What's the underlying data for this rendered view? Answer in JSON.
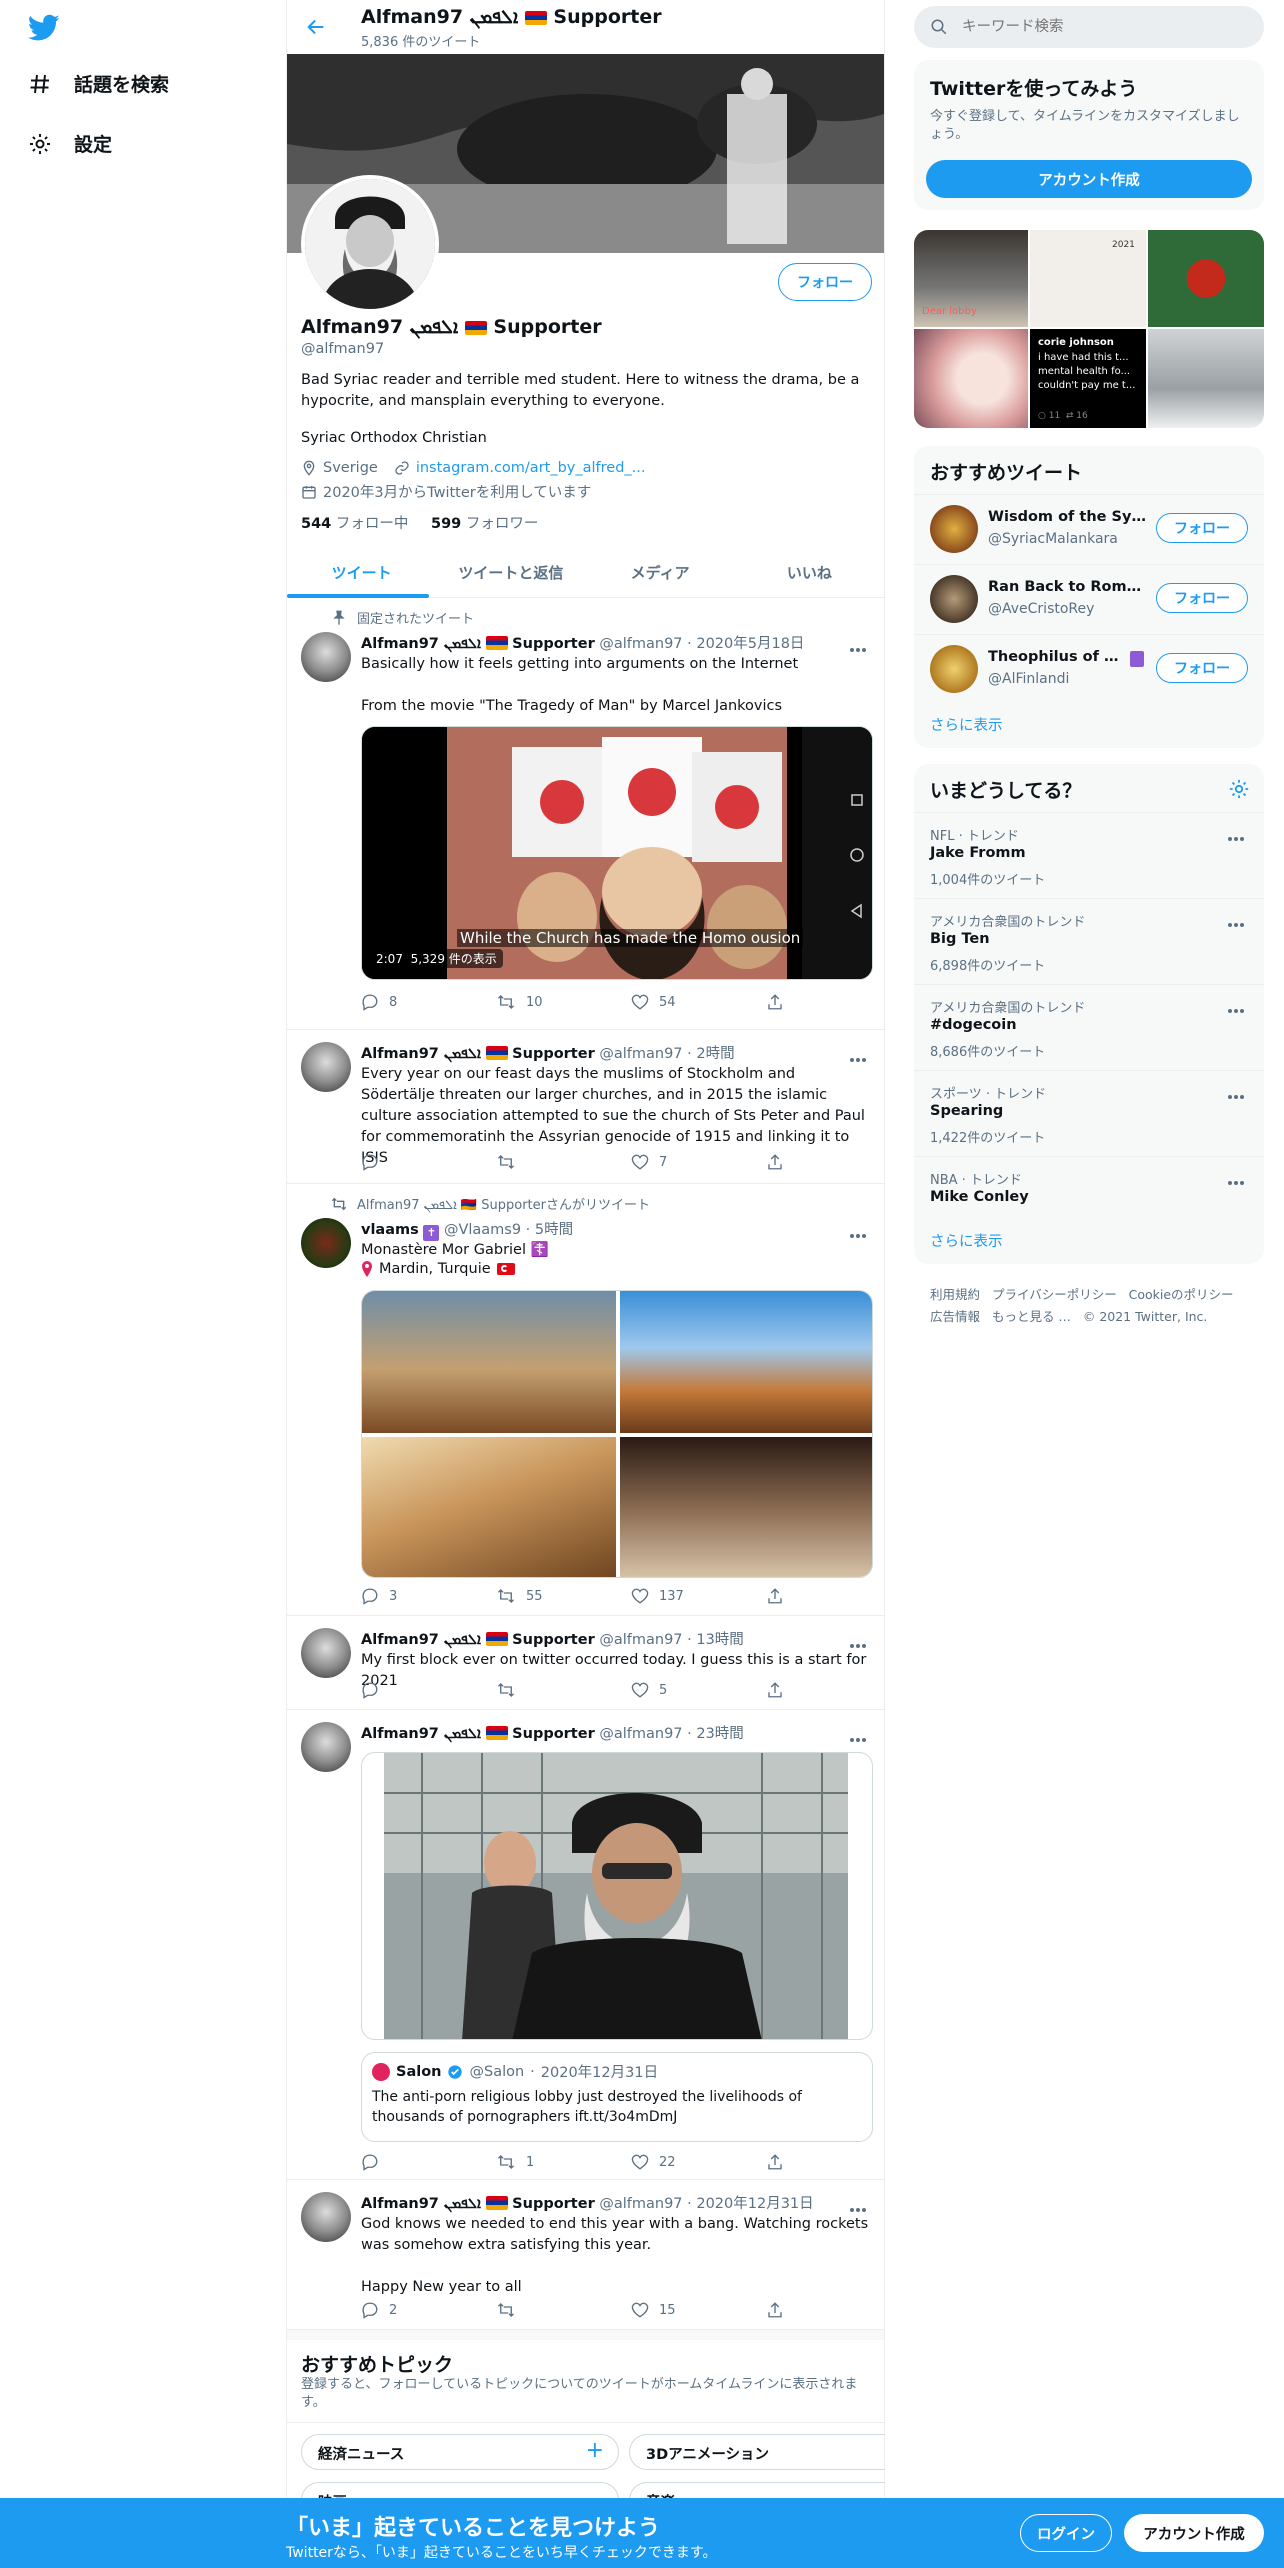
{
  "nav": {
    "explore_label": "話題を検索",
    "settings_label": "設定"
  },
  "header": {
    "name": "Alfman97 ܐܠܦܡܢ",
    "supporter": "Supporter",
    "tweet_count": "5,836 件のツイート"
  },
  "profile": {
    "name": "Alfman97 ܐܠܦܡܢ",
    "supporter": "Supporter",
    "handle": "@alfman97",
    "follow_label": "フォロー",
    "bio": "Bad Syriac reader and terrible med student. Here to witness the drama, be a hypocrite, and mansplain everything to everyone.",
    "bio2": "Syriac Orthodox Christian",
    "location": "Sverige",
    "link": "instagram.com/art_by_alfred_...",
    "joined": "2020年3月からTwitterを利用しています",
    "following_count": "544",
    "following_label": "フォロー中",
    "followers_count": "599",
    "followers_label": "フォロワー"
  },
  "tabs": [
    "ツイート",
    "ツイートと返信",
    "メディア",
    "いいね"
  ],
  "tweets": [
    {
      "pinned_label": "固定されたツイート",
      "name": "Alfman97 ܐܠܦܡܢ",
      "supporter": "Supporter",
      "handle": "@alfman97",
      "time": "2020年5月18日",
      "text": "Basically how it feels getting into arguments on the Internet\n\nFrom the movie \"The Tragedy of Man\" by Marcel Jankovics",
      "video_caption": "While the Church has made the Homo ousion",
      "video_duration": "2:07",
      "video_views": "5,329 件の表示",
      "replies": "8",
      "retweets": "10",
      "likes": "54"
    },
    {
      "name": "Alfman97 ܐܠܦܡܢ",
      "supporter": "Supporter",
      "handle": "@alfman97",
      "time": "2時間",
      "text": "Every year on our feast days the muslims of Stockholm and Södertälje threaten our larger churches, and in 2015 the islamic culture association attempted to sue the church of Sts Peter and Paul for commemoratinh the Assyrian genocide of 1915 and linking it to ISIS",
      "replies": "",
      "retweets": "",
      "likes": "7"
    },
    {
      "retweet_label": "Alfman97 ܐܠܦܡܢ 🇦🇲 Supporterさんがリツイート",
      "name": "vlaams",
      "handle": "@Vlaams9",
      "time": "5時間",
      "text_line1": "Monastère Mor Gabriel ☦️",
      "text_line2": "Mardin, Turquie",
      "replies": "3",
      "retweets": "55",
      "likes": "137"
    },
    {
      "name": "Alfman97 ܐܠܦܡܢ",
      "supporter": "Supporter",
      "handle": "@alfman97",
      "time": "13時間",
      "text": "My first block ever on twitter occurred today. I guess this is a start for 2021",
      "replies": "",
      "retweets": "",
      "likes": "5"
    },
    {
      "name": "Alfman97 ܐܠܦܡܢ",
      "supporter": "Supporter",
      "handle": "@alfman97",
      "time": "23時間",
      "quote_name": "Salon",
      "quote_handle": "@Salon",
      "quote_time": "2020年12月31日",
      "quote_text": "The anti-porn religious lobby just destroyed the livelihoods of thousands of pornographers ift.tt/3o4mDmJ",
      "replies": "",
      "retweets": "1",
      "likes": "22"
    },
    {
      "name": "Alfman97 ܐܠܦܡܢ",
      "supporter": "Supporter",
      "handle": "@alfman97",
      "time": "2020年12月31日",
      "text": "God knows we needed to end this year with a bang. Watching rockets was somehow extra satisfying this year.\n\nHappy New year to all",
      "replies": "2",
      "retweets": "",
      "likes": "15"
    }
  ],
  "topics": {
    "title": "おすすめトピック",
    "subtitle": "登録すると、フォローしているトピックについてのツイートがホームタイムラインに表示されます。",
    "items": [
      "経済ニュース",
      "3Dアニメーション",
      "映画",
      "音楽"
    ]
  },
  "search": {
    "placeholder": "キーワード検索"
  },
  "signup": {
    "title": "Twitterを使ってみよう",
    "desc": "今すぐ登録して、タイムラインをカスタマイズしましょう。",
    "button": "アカウント作成"
  },
  "media_grid": {
    "cell1_caption": "Dear lobby",
    "cell2_caption": "2021",
    "cell5_name": "corie johnson",
    "cell5_text": "i have had this t... mental health fo... couldn't pay me t...",
    "cell5_replies": "11",
    "cell5_retweets": "16"
  },
  "recommended": {
    "title": "おすすめツイート",
    "users": [
      {
        "name": "Wisdom of the Syriac...",
        "handle": "@SyriacMalankara",
        "button": "フォロー",
        "color": "#8a4b1e"
      },
      {
        "name": "Ran Back to Rome M...",
        "handle": "@AveCristoRey",
        "button": "フォロー",
        "color": "#6b5a44"
      },
      {
        "name": "Theophilus of Finland",
        "handle": "@AlFinlandi",
        "button": "フォロー",
        "color": "#c89a2a"
      }
    ],
    "more": "さらに表示"
  },
  "trends": {
    "title": "いまどうしてる？",
    "items": [
      {
        "category": "NFL · トレンド",
        "name": "Jake Fromm",
        "count": "1,004件のツイート"
      },
      {
        "category": "アメリカ合衆国のトレンド",
        "name": "Big Ten",
        "count": "6,898件のツイート"
      },
      {
        "category": "アメリカ合衆国のトレンド",
        "name": "#dogecoin",
        "count": "8,686件のツイート"
      },
      {
        "category": "スポーツ · トレンド",
        "name": "Spearing",
        "count": "1,422件のツイート"
      },
      {
        "category": "NBA · トレンド",
        "name": "Mike Conley",
        "count": ""
      }
    ],
    "more": "さらに表示"
  },
  "footer": {
    "links": [
      "利用規約",
      "プライバシーポリシー",
      "Cookieのポリシー",
      "広告情報",
      "もっと見る …"
    ],
    "copyright": "© 2021 Twitter, Inc."
  },
  "bottombar": {
    "title": "「いま」起きていることを見つけよう",
    "subtitle": "Twitterなら、「いま」起きていることをいち早くチェックできます。",
    "login": "ログイン",
    "signup": "アカウント作成"
  },
  "colors": {
    "accent": "#1d9bf0",
    "muted": "#5b7083",
    "border": "#ebeef0"
  }
}
